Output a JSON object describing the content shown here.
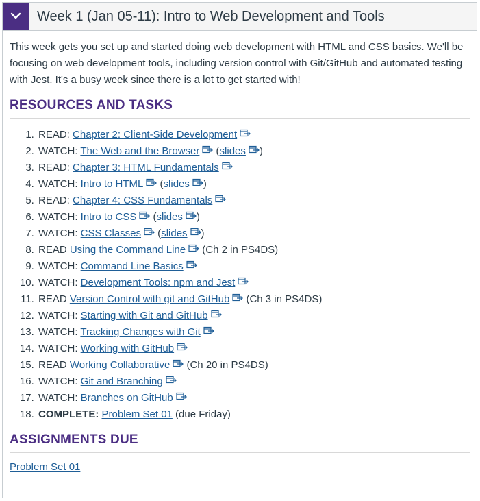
{
  "module": {
    "title": "Week 1 (Jan 05-11): Intro to Web Development and Tools",
    "intro": "This week gets you set up and started doing web development with HTML and CSS basics. We'll be focusing on web development tools, including version control with Git/GitHub and automated testing with Jest. It's a busy week since there is a lot to get started with!",
    "resources_heading": "RESOURCES AND TASKS",
    "assignments_heading": "ASSIGNMENTS DUE",
    "assignment_link": "Problem Set 01"
  },
  "tasks": [
    {
      "prefix": "READ: ",
      "link": "Chapter 2: Client-Side Development",
      "ext": true
    },
    {
      "prefix": "WATCH: ",
      "link": "The Web and the Browser",
      "ext": true,
      "slides": "slides"
    },
    {
      "prefix": "READ: ",
      "link": "Chapter 3: HTML Fundamentals",
      "ext": true
    },
    {
      "prefix": "WATCH: ",
      "link": "Intro to HTML",
      "ext": true,
      "slides": "slides"
    },
    {
      "prefix": "READ: ",
      "link": "Chapter 4: CSS Fundamentals",
      "ext": true
    },
    {
      "prefix": "WATCH: ",
      "link": "Intro to CSS",
      "ext": true,
      "slides": "slides"
    },
    {
      "prefix": "WATCH: ",
      "link": "CSS Classes",
      "ext": true,
      "slides": "slides"
    },
    {
      "prefix": "READ ",
      "link": "Using the Command Line",
      "ext": true,
      "suffix": " (Ch 2 in PS4DS)"
    },
    {
      "prefix": "WATCH: ",
      "link": "Command Line Basics",
      "ext": true
    },
    {
      "prefix": "WATCH: ",
      "link": "Development Tools: npm and Jest",
      "ext": true
    },
    {
      "prefix": "READ ",
      "link": "Version Control with git and GitHub",
      "ext": true,
      "suffix": " (Ch 3 in PS4DS)"
    },
    {
      "prefix": "WATCH: ",
      "link": "Starting with Git and GitHub",
      "ext": true
    },
    {
      "prefix": "WATCH: ",
      "link": "Tracking Changes with Git",
      "ext": true
    },
    {
      "prefix": "WATCH: ",
      "link": "Working with GitHub",
      "ext": true
    },
    {
      "prefix": "READ ",
      "link": "Working Collaborative",
      "ext": true,
      "suffix": " (Ch 20 in PS4DS)"
    },
    {
      "prefix": "WATCH: ",
      "link": "Git and Branching",
      "ext": true
    },
    {
      "prefix": "WATCH: ",
      "link": "Branches on GitHub",
      "ext": true
    },
    {
      "prefix": "COMPLETE: ",
      "bold": true,
      "link": "Problem Set 01",
      "ext": false,
      "suffix": " (due Friday)"
    }
  ],
  "icons": {
    "toggle": "chevron-down-icon",
    "external": "external-link-icon"
  },
  "colors": {
    "accent": "#4b2e83",
    "link": "#1f5e97",
    "text": "#2d3b45"
  }
}
